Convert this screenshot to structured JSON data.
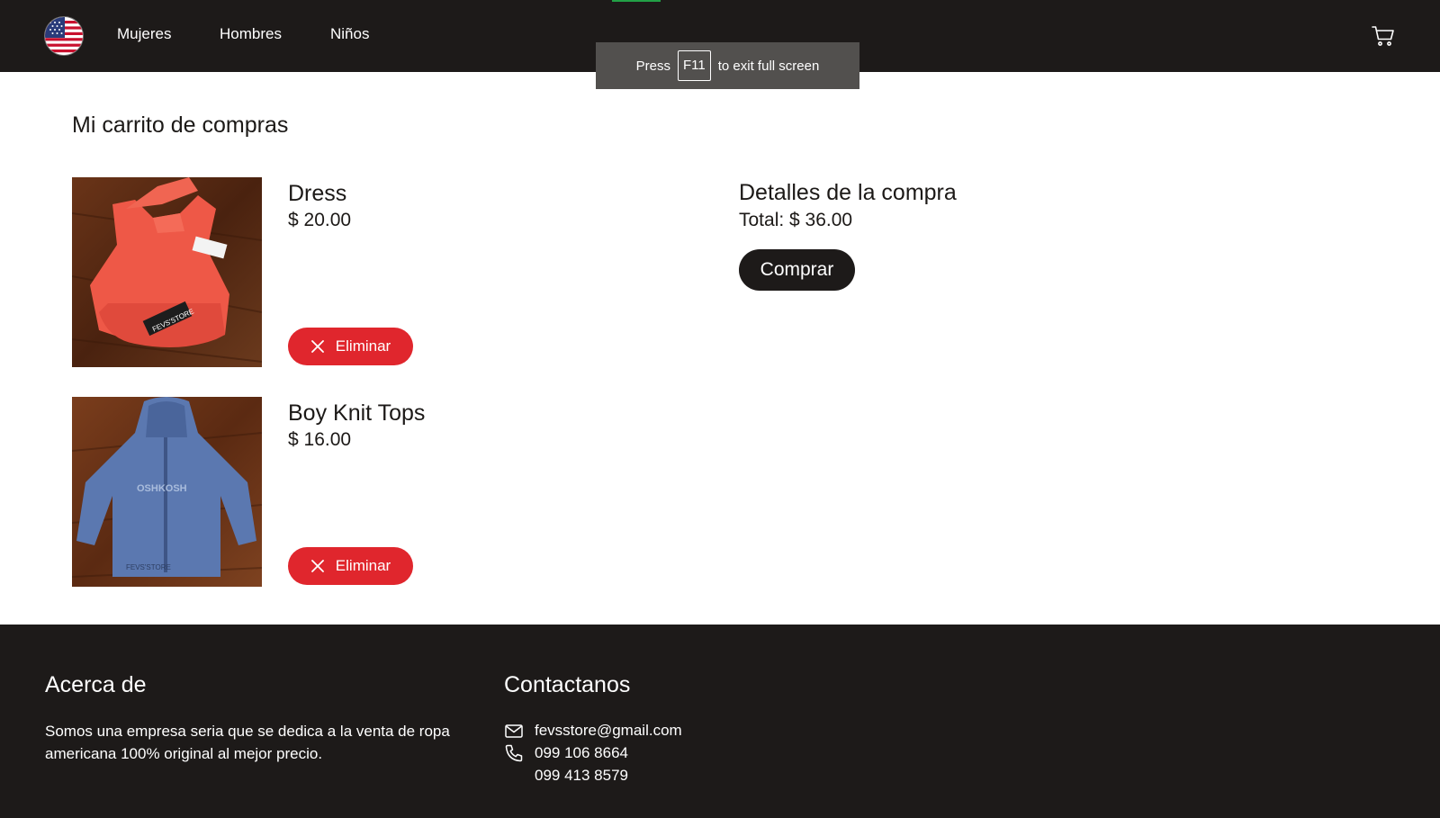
{
  "header": {
    "logo_icon": "us-flag-icon",
    "nav": [
      "Mujeres",
      "Hombres",
      "Niños"
    ],
    "cart_icon": "shopping-cart-icon"
  },
  "fullscreen_notice": {
    "before": "Press",
    "key": "F11",
    "after": "to exit full screen"
  },
  "cart": {
    "title": "Mi carrito de compras",
    "items": [
      {
        "name": "Dress",
        "price": "$ 20.00",
        "remove_label": "Eliminar",
        "image": "red-dress-photo"
      },
      {
        "name": "Boy Knit Tops",
        "price": "$ 16.00",
        "remove_label": "Eliminar",
        "image": "blue-hoodie-photo"
      }
    ]
  },
  "summary": {
    "title": "Detalles de la compra",
    "total_label": "Total:",
    "total_value": "$ 36.00",
    "buy_label": "Comprar"
  },
  "footer": {
    "about": {
      "heading": "Acerca de",
      "text": "Somos una empresa seria que se dedica a la venta de ropa americana 100% original al mejor precio."
    },
    "contact": {
      "heading": "Contactanos",
      "email": "fevsstore@gmail.com",
      "phones": [
        "099 106 8664",
        "099 413 8579"
      ]
    }
  },
  "colors": {
    "header_bg": "#1d1a19",
    "remove_button": "#e0262d",
    "buy_button": "#1d1a19"
  }
}
